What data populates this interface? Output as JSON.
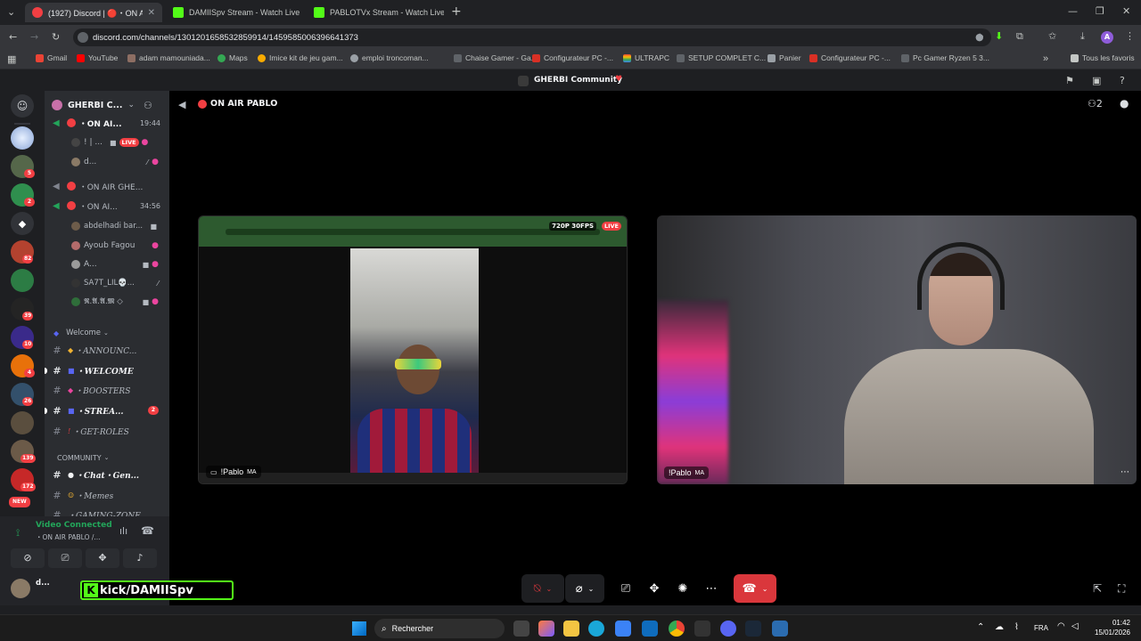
{
  "browser": {
    "tabs": [
      {
        "title": "(1927) Discord | 🔴・ON AIR",
        "active": true
      },
      {
        "title": "DAMIISpv Stream - Watch Live",
        "active": false
      },
      {
        "title": "PABLOTVx Stream - Watch Live",
        "active": false
      }
    ],
    "new_tab": "+",
    "url": "discord.com/channels/1301201658532859914/1459585006396641373",
    "bookmarks": [
      "Gmail",
      "YouTube",
      "adam mamouniada...",
      "Maps",
      "Imice kit de jeu gam...",
      "emploi troncoman...",
      "Chaise Gamer - Ga...",
      "Configurateur PC -...",
      "ULTRAPC",
      "SETUP COMPLET C...",
      "Panier",
      "Configurateur PC -...",
      "Pc Gamer Ryzen 5 3..."
    ],
    "bookmarks_overflow": "»",
    "all_bookmarks": "Tous les favoris",
    "profile_initial": "A"
  },
  "discord": {
    "server_title": "GHERBI Community",
    "server_name": "GHERBI C...",
    "call_title": "ON AIR PABLO",
    "server_badges": [
      "5",
      "2",
      "82",
      "39",
      "10",
      "4",
      "26",
      "139",
      "172"
    ],
    "new_badge": "NEW",
    "channels": [
      {
        "type": "voice",
        "name": "・ON AI...",
        "time": "19:44",
        "bold": true
      },
      {
        "type": "user",
        "name": "! | ...",
        "live": "LIVE"
      },
      {
        "type": "user",
        "name": "d..."
      },
      {
        "type": "voice",
        "name": "・ON AIR GHE...",
        "bold": false
      },
      {
        "type": "voice",
        "name": "・ON AI...",
        "time": "34:56"
      },
      {
        "type": "user",
        "name": "abdelhadi bar..."
      },
      {
        "type": "user",
        "name": "Ayoub Fagou"
      },
      {
        "type": "user",
        "name": "A..."
      },
      {
        "type": "user",
        "name": "SA7T_LIL💀..."
      },
      {
        "type": "user",
        "name": "𝕽.𝕬.𝕬.𝕸 ◇"
      }
    ],
    "category_welcome": "Welcome",
    "text_channels": [
      {
        "name": "・ANNOUNC...",
        "bold": false
      },
      {
        "name": "・WELCOME",
        "bold": true
      },
      {
        "name": "・BOOSTERS",
        "bold": false
      },
      {
        "name": "・STREA...",
        "bold": true,
        "badge": "2"
      },
      {
        "name": "・GET-ROLES",
        "bold": false
      }
    ],
    "category_community": "COMMUNITY",
    "community_channels": [
      {
        "name": "・Chat・Gen...",
        "bold": true
      },
      {
        "name": "・Memes",
        "bold": false
      },
      {
        "name": "・GAMING-ZONE",
        "bold": false
      }
    ],
    "voice_status": "Video Connected",
    "voice_channel": "・ON AIR PABLO /...",
    "user_name": "d...",
    "overlay_text": "kick/DAMIISpv",
    "tile1": {
      "quality": "720P 30FPS",
      "live": "LIVE",
      "name": "!Pablo",
      "tag": "MA"
    },
    "tile2": {
      "name": "!Pablo",
      "tag": "MA"
    }
  },
  "taskbar": {
    "search": "Rechercher",
    "lang": "FRA",
    "time": "01:42",
    "date": "15/01/2026"
  },
  "colors": {
    "blurple": "#5865f2",
    "red": "#da373c",
    "live": "#f23f43",
    "green": "#23a55a",
    "kick": "#53fc18"
  }
}
